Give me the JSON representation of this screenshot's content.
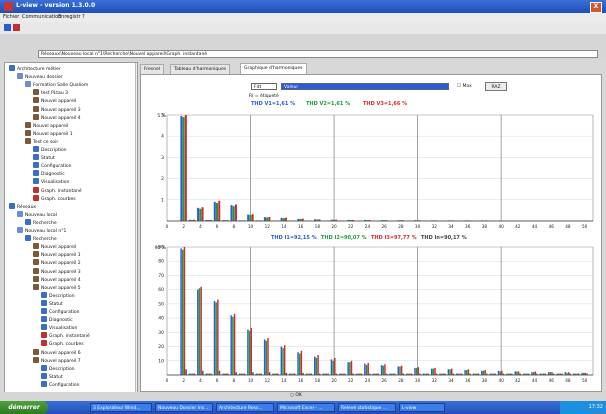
{
  "window": {
    "title": "L-view - version 1.3.0.0",
    "close_glyph": "X"
  },
  "menu": [
    "Fichier",
    "Communication",
    "Enregistr",
    "?"
  ],
  "path": "Réseaux\\Nouveau local n°1\\Recherche\\Nouvel appareil\\Graph. instantané",
  "tree": [
    {
      "label": "Architecture métier",
      "indent": 0,
      "icon": "folder-icon",
      "color": "#3a6fc8"
    },
    {
      "label": "Nouveau dossier",
      "indent": 1,
      "icon": "folder-icon",
      "color": "#6a8fd0"
    },
    {
      "label": "Formation Salle Qualiom",
      "indent": 2,
      "icon": "folder-icon",
      "color": "#6a8fd0"
    },
    {
      "label": "test PLtau 3",
      "indent": 3,
      "icon": "device-icon",
      "color": "#7c5a3a"
    },
    {
      "label": "Nouvel appareil",
      "indent": 3,
      "icon": "device-icon",
      "color": "#7c5a3a"
    },
    {
      "label": "Nouvel appareil 3",
      "indent": 3,
      "icon": "device-icon",
      "color": "#7c5a3a"
    },
    {
      "label": "Nouvel appareil 4",
      "indent": 3,
      "icon": "device-icon",
      "color": "#7c5a3a"
    },
    {
      "label": "Nouvel appareil",
      "indent": 2,
      "icon": "device-icon",
      "color": "#7c5a3a"
    },
    {
      "label": "Nouvel appareil 1",
      "indent": 2,
      "icon": "device-icon",
      "color": "#7c5a3a"
    },
    {
      "label": "Test ce soir",
      "indent": 2,
      "icon": "device-icon",
      "color": "#7c5a3a"
    },
    {
      "label": "Description",
      "indent": 3,
      "icon": "info-icon",
      "color": "#3a6fc8"
    },
    {
      "label": "Statut",
      "indent": 3,
      "icon": "status-icon",
      "color": "#3a6fc8"
    },
    {
      "label": "Configuration",
      "indent": 3,
      "icon": "config-icon",
      "color": "#3a6fc8"
    },
    {
      "label": "Diagnostic",
      "indent": 3,
      "icon": "diagnostic-icon",
      "color": "#3a6fc8"
    },
    {
      "label": "Visualisation",
      "indent": 3,
      "icon": "chart-icon",
      "color": "#3a6fc8"
    },
    {
      "label": "Graph. instantané",
      "indent": 3,
      "icon": "chart-icon",
      "color": "#c03030"
    },
    {
      "label": "Graph. courbes",
      "indent": 3,
      "icon": "chart-icon",
      "color": "#c03030"
    },
    {
      "label": "Réseaux",
      "indent": 0,
      "icon": "network-icon",
      "color": "#3a6fc8"
    },
    {
      "label": "Nouveau local",
      "indent": 1,
      "icon": "folder-icon",
      "color": "#6a8fd0"
    },
    {
      "label": "Recherche",
      "indent": 2,
      "icon": "search-icon",
      "color": "#3a6fc8"
    },
    {
      "label": "Nouveau local n°1",
      "indent": 1,
      "icon": "folder-icon",
      "color": "#6a8fd0"
    },
    {
      "label": "Recherche",
      "indent": 2,
      "icon": "search-icon",
      "color": "#3a6fc8"
    },
    {
      "label": "Nouvel appareil",
      "indent": 3,
      "icon": "device-icon",
      "color": "#7c5a3a"
    },
    {
      "label": "Nouvel appareil 1",
      "indent": 3,
      "icon": "device-icon",
      "color": "#7c5a3a"
    },
    {
      "label": "Nouvel appareil 2",
      "indent": 3,
      "icon": "device-icon",
      "color": "#7c5a3a"
    },
    {
      "label": "Nouvel appareil 3",
      "indent": 3,
      "icon": "device-icon",
      "color": "#7c5a3a"
    },
    {
      "label": "Nouvel appareil 4",
      "indent": 3,
      "icon": "device-icon",
      "color": "#7c5a3a"
    },
    {
      "label": "Nouvel appareil 5",
      "indent": 3,
      "icon": "device-icon",
      "color": "#7c5a3a"
    },
    {
      "label": "Description",
      "indent": 4,
      "icon": "info-icon",
      "color": "#3a6fc8"
    },
    {
      "label": "Statut",
      "indent": 4,
      "icon": "status-icon",
      "color": "#3a6fc8"
    },
    {
      "label": "Configuration",
      "indent": 4,
      "icon": "config-icon",
      "color": "#3a6fc8"
    },
    {
      "label": "Diagnostic",
      "indent": 4,
      "icon": "diagnostic-icon",
      "color": "#3a6fc8"
    },
    {
      "label": "Visualisation",
      "indent": 4,
      "icon": "chart-icon",
      "color": "#3a6fc8"
    },
    {
      "label": "Graph. instantané",
      "indent": 4,
      "icon": "chart-icon",
      "color": "#c03030"
    },
    {
      "label": "Graph. courbes",
      "indent": 4,
      "icon": "chart-icon",
      "color": "#c03030"
    },
    {
      "label": "Nouvel appareil 6",
      "indent": 3,
      "icon": "device-icon",
      "color": "#7c5a3a"
    },
    {
      "label": "Nouvel appareil 7",
      "indent": 3,
      "icon": "device-icon",
      "color": "#7c5a3a"
    },
    {
      "label": "Description",
      "indent": 4,
      "icon": "info-icon",
      "color": "#3a6fc8"
    },
    {
      "label": "Statut",
      "indent": 4,
      "icon": "status-icon",
      "color": "#3a6fc8"
    },
    {
      "label": "Configuration",
      "indent": 4,
      "icon": "config-icon",
      "color": "#3a6fc8"
    }
  ],
  "tabs": [
    {
      "label": "Fresnel",
      "active": false
    },
    {
      "label": "Tableau d'harmoniques",
      "active": false
    },
    {
      "label": "Graphique d'harmoniques",
      "active": true
    }
  ],
  "controls": {
    "mode_select": "Fdt",
    "source_select": "Valeur",
    "checkbox_label": "Max",
    "reset_button": "RAZ",
    "ref_label": "Ri = étiqueté"
  },
  "thd_top": [
    {
      "label": "THD V1=1,61 %",
      "color": "#2a5bd7"
    },
    {
      "label": "THD V2=1,61 %",
      "color": "#1e9a3a"
    },
    {
      "label": "THD V3=1,66 %",
      "color": "#d62a2a"
    }
  ],
  "thd_bottom": [
    {
      "label": "THD I1=92,15 %",
      "color": "#2a5bd7"
    },
    {
      "label": "THD I2=90,07 %",
      "color": "#1e9a3a"
    },
    {
      "label": "THD I3=97,77 %",
      "color": "#d62a2a"
    },
    {
      "label": "THD In=90,17 %",
      "color": "#444444"
    }
  ],
  "status": {
    "ok_label": "OK"
  },
  "taskbar": {
    "start": "démarrer",
    "tasks": [
      "3 Explorateur Wind...",
      "Nouveau Dossier Ins...",
      "Architecture Ress...",
      "Microsoft Excel - ...",
      "Relevé statistique ...",
      "L-view"
    ],
    "clock": "17:32"
  },
  "chart_data": [
    {
      "type": "bar",
      "title": "Voltage harmonics",
      "ylabel": "%",
      "ymax_label": "5 %",
      "ylim": [
        0,
        5
      ],
      "categories": [
        "2",
        "3",
        "4",
        "5",
        "6",
        "7",
        "8",
        "9",
        "10",
        "11",
        "12",
        "13",
        "14",
        "15",
        "16",
        "17",
        "18",
        "19",
        "20",
        "21",
        "22",
        "23",
        "24",
        "25",
        "26",
        "27",
        "28",
        "29",
        "30",
        "31",
        "32",
        "33",
        "34",
        "35",
        "36",
        "37",
        "38",
        "39",
        "40",
        "41",
        "42",
        "43",
        "44",
        "45",
        "46",
        "47",
        "48",
        "49",
        "50"
      ],
      "tick_labels": [
        "0",
        "2",
        "4",
        "6",
        "8",
        "10",
        "12",
        "14",
        "16",
        "18",
        "20",
        "22",
        "24",
        "26",
        "28",
        "30",
        "32",
        "34",
        "36",
        "38",
        "40",
        "42",
        "44",
        "46",
        "48",
        "50"
      ],
      "y_ticks": [
        "1",
        "2",
        "3",
        "4",
        "5"
      ],
      "series": [
        {
          "name": "V1",
          "color": "#2a5bd7",
          "values": [
            4.95,
            0.06,
            0.62,
            0.05,
            0.9,
            0.04,
            0.75,
            0.03,
            0.3,
            0.03,
            0.18,
            0.02,
            0.15,
            0.02,
            0.1,
            0.02,
            0.08,
            0.02,
            0.06,
            0.02,
            0.05,
            0.02,
            0.05,
            0.02,
            0.04,
            0.02,
            0.04,
            0.02,
            0.04,
            0.02,
            0.03,
            0.02,
            0.03,
            0.02,
            0.03,
            0.02,
            0.03,
            0.02,
            0.02,
            0.02,
            0.02,
            0.02,
            0.02,
            0.02,
            0.02,
            0.02,
            0.02,
            0.02,
            0.02
          ]
        },
        {
          "name": "V2",
          "color": "#1e9a3a",
          "values": [
            4.9,
            0.05,
            0.58,
            0.05,
            0.85,
            0.04,
            0.7,
            0.03,
            0.28,
            0.03,
            0.17,
            0.02,
            0.14,
            0.02,
            0.1,
            0.02,
            0.07,
            0.02,
            0.06,
            0.02,
            0.05,
            0.02,
            0.04,
            0.02,
            0.04,
            0.02,
            0.04,
            0.02,
            0.03,
            0.02,
            0.03,
            0.02,
            0.03,
            0.02,
            0.03,
            0.02,
            0.02,
            0.02,
            0.02,
            0.02,
            0.02,
            0.02,
            0.02,
            0.02,
            0.02,
            0.02,
            0.02,
            0.02,
            0.02
          ]
        },
        {
          "name": "V3",
          "color": "#d62a2a",
          "values": [
            5.0,
            0.06,
            0.65,
            0.05,
            0.95,
            0.04,
            0.78,
            0.03,
            0.32,
            0.03,
            0.19,
            0.02,
            0.16,
            0.02,
            0.11,
            0.02,
            0.08,
            0.02,
            0.06,
            0.02,
            0.05,
            0.02,
            0.05,
            0.02,
            0.04,
            0.02,
            0.04,
            0.02,
            0.04,
            0.02,
            0.03,
            0.02,
            0.03,
            0.02,
            0.03,
            0.02,
            0.03,
            0.02,
            0.02,
            0.02,
            0.02,
            0.02,
            0.02,
            0.02,
            0.02,
            0.02,
            0.02,
            0.02,
            0.02
          ]
        }
      ],
      "grid": true
    },
    {
      "type": "bar",
      "title": "Current harmonics",
      "ylabel": "%",
      "ymax_label": "90 %",
      "ylim": [
        0,
        90
      ],
      "categories": [
        "2",
        "3",
        "4",
        "5",
        "6",
        "7",
        "8",
        "9",
        "10",
        "11",
        "12",
        "13",
        "14",
        "15",
        "16",
        "17",
        "18",
        "19",
        "20",
        "21",
        "22",
        "23",
        "24",
        "25",
        "26",
        "27",
        "28",
        "29",
        "30",
        "31",
        "32",
        "33",
        "34",
        "35",
        "36",
        "37",
        "38",
        "39",
        "40",
        "41",
        "42",
        "43",
        "44",
        "45",
        "46",
        "47",
        "48",
        "49",
        "50"
      ],
      "tick_labels": [
        "0",
        "2",
        "4",
        "6",
        "8",
        "10",
        "12",
        "14",
        "16",
        "18",
        "20",
        "22",
        "24",
        "26",
        "28",
        "30",
        "32",
        "34",
        "36",
        "38",
        "40",
        "42",
        "44",
        "46",
        "48",
        "50"
      ],
      "y_ticks": [
        "10",
        "20",
        "30",
        "40",
        "50",
        "60",
        "70",
        "80",
        "90"
      ],
      "series": [
        {
          "name": "I1",
          "color": "#2a5bd7",
          "values": [
            89,
            1,
            60,
            1,
            52,
            1,
            42,
            1,
            32,
            1,
            25,
            1,
            20,
            1,
            16,
            1,
            13,
            1,
            11,
            1,
            9,
            1,
            8,
            1,
            7,
            1,
            6,
            1,
            5,
            1,
            4.5,
            1,
            4,
            1,
            3.5,
            1,
            3,
            1,
            3,
            1,
            2.5,
            1,
            2,
            1,
            2,
            1,
            2,
            1,
            1.5
          ]
        },
        {
          "name": "I2",
          "color": "#1e9a3a",
          "values": [
            88,
            1,
            61,
            1,
            51,
            1,
            41,
            1,
            31,
            1,
            24,
            1,
            19,
            1,
            15,
            1,
            12,
            1,
            10,
            1,
            9,
            1,
            7,
            1,
            6.5,
            1,
            6,
            1,
            5,
            1,
            4.5,
            1,
            4,
            1,
            3.5,
            1,
            3,
            1,
            2.5,
            1,
            2.5,
            1,
            2,
            1,
            2,
            1,
            1.5,
            1,
            1.5
          ]
        },
        {
          "name": "I3",
          "color": "#d62a2a",
          "values": [
            90,
            1,
            62,
            1,
            53,
            1,
            43,
            1,
            33,
            1,
            26,
            1,
            21,
            1,
            17,
            1,
            14,
            1,
            12,
            1,
            10,
            1,
            8.5,
            1,
            7.5,
            1,
            6.5,
            1,
            5.5,
            1,
            5,
            1,
            4.5,
            1,
            4,
            1,
            3.5,
            1,
            3,
            1,
            2.5,
            1,
            2.5,
            1,
            2,
            1,
            2,
            1,
            1.5
          ]
        },
        {
          "name": "In",
          "color": "#555555",
          "values": [
            4,
            1,
            3,
            1,
            3,
            1,
            2,
            1,
            2,
            1,
            2,
            1,
            1.5,
            1,
            1.5,
            1,
            1,
            1,
            1,
            1,
            1,
            1,
            1,
            1,
            1,
            1,
            1,
            1,
            1,
            1,
            1,
            1,
            1,
            1,
            1,
            1,
            1,
            1,
            1,
            1,
            1,
            1,
            1,
            1,
            1,
            1,
            1,
            1,
            1
          ]
        }
      ],
      "grid": true
    }
  ]
}
